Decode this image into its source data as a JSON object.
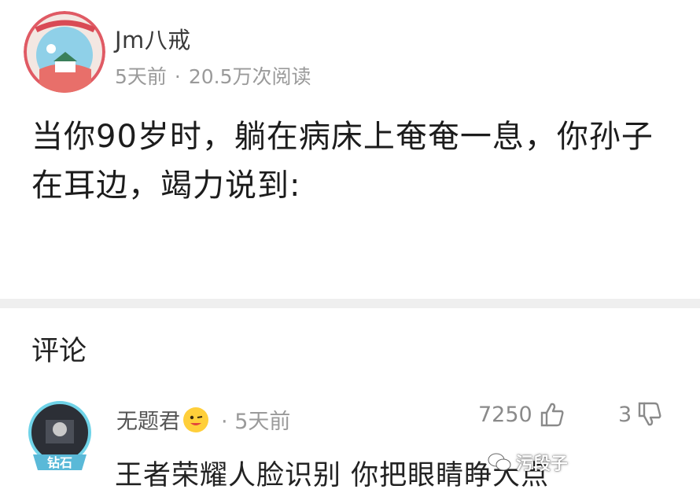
{
  "post": {
    "author": "Jm八戒",
    "time_ago": "5天前",
    "separator": "·",
    "views": "20.5万次阅读",
    "text": "当你90岁时，躺在病床上奄奄一息，你孙子在耳边，竭力说到:"
  },
  "comments": {
    "heading": "评论",
    "items": [
      {
        "user": "无题君",
        "time_ago": "5天前",
        "separator": "·",
        "likes": "7250",
        "dislikes": "3",
        "badge": "钻石",
        "text": "王者荣耀人脸识别 你把眼睛睁大点"
      }
    ]
  },
  "watermark": {
    "text": "污段子"
  },
  "colors": {
    "meta_gray": "#9a9a9a",
    "divider": "#efefef",
    "emoji_yellow": "#ffcf3a"
  },
  "icons": [
    "thumbs-up-icon",
    "thumbs-down-icon",
    "wechat-icon"
  ]
}
